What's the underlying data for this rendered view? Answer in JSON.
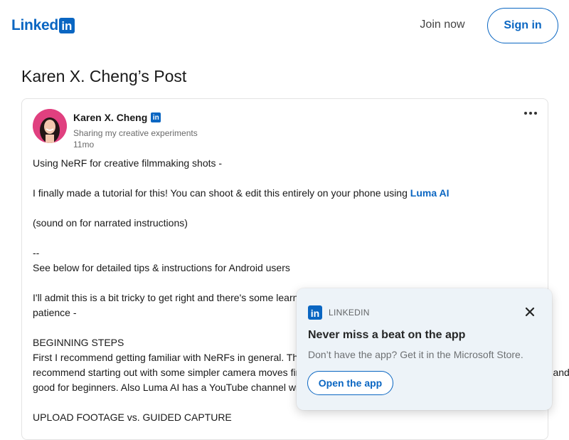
{
  "header": {
    "logo_text": "Linked",
    "logo_box": "in",
    "join_now": "Join now",
    "sign_in": "Sign in"
  },
  "page_title": "Karen X. Cheng’s Post",
  "post": {
    "author": "Karen X. Cheng",
    "badge": "in",
    "headline": "Sharing my creative experiments",
    "time": "11mo",
    "lines": {
      "l1": "Using NeRF for creative filmmaking shots -",
      "l2": "I finally made a tutorial for this! You can shoot & edit this entirely on your phone using ",
      "l2_link": "Luma AI",
      "l3": "(sound on for narrated instructions)",
      "l4": "--",
      "l5": "See below for detailed tips & instructions for Android users",
      "l6": "I'll admit this is a bit tricky to get right and there's some learning curve involved. It will take some time and",
      "l7": "patience -",
      "l8": "BEGINNING STEPS",
      "l9": "First I recommend getting familiar with NeRFs in general. There are lots of resources online but I",
      "l10": "recommend starting out with some simpler camera moves first. Orbit shots around an object are a really fun one to do and",
      "l11": "good for beginners. Also Luma AI has a YouTube channel with lots of tutorials, check those out if you get stuck.",
      "l12": "UPLOAD FOOTAGE vs. GUIDED CAPTURE"
    }
  },
  "popup": {
    "logo": "in",
    "brand": "LINKEDIN",
    "title": "Never miss a beat on the app",
    "subtitle": "Don’t have the app? Get it in the Microsoft Store.",
    "button": "Open the app"
  },
  "colors": {
    "brand": "#0a66c2",
    "popup_bg": "#edf3f8"
  }
}
